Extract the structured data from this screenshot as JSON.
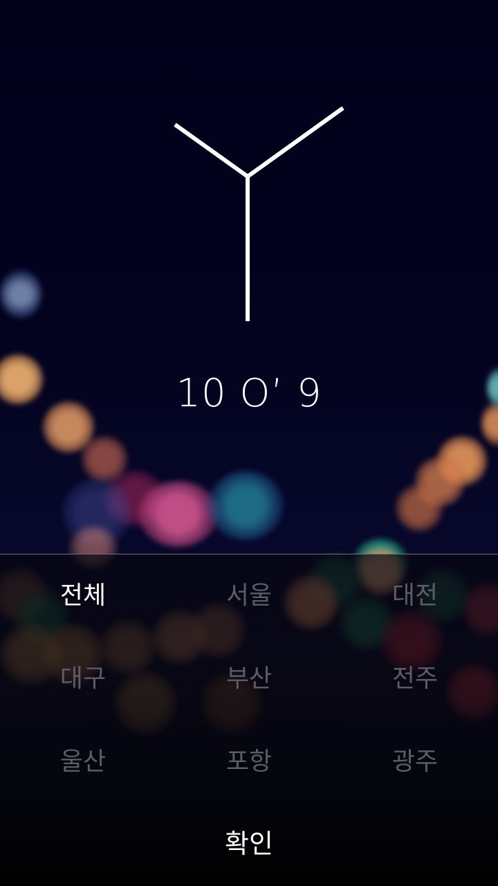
{
  "clock": {
    "time_text": "10 O’ 9",
    "hand_color": "#ffffff"
  },
  "region_picker": {
    "regions": [
      {
        "label": "전체",
        "selected": true
      },
      {
        "label": "서울",
        "selected": false
      },
      {
        "label": "대전",
        "selected": false
      },
      {
        "label": "대구",
        "selected": false
      },
      {
        "label": "부산",
        "selected": false
      },
      {
        "label": "전주",
        "selected": false
      },
      {
        "label": "울산",
        "selected": false
      },
      {
        "label": "포항",
        "selected": false
      },
      {
        "label": "광주",
        "selected": false
      }
    ],
    "selected_color": "#ffffff",
    "unselected_color": "#5c5c66"
  },
  "confirm": {
    "label": "확인"
  },
  "colors": {
    "background": "#02021e",
    "panel_divider": "#ffffff"
  }
}
